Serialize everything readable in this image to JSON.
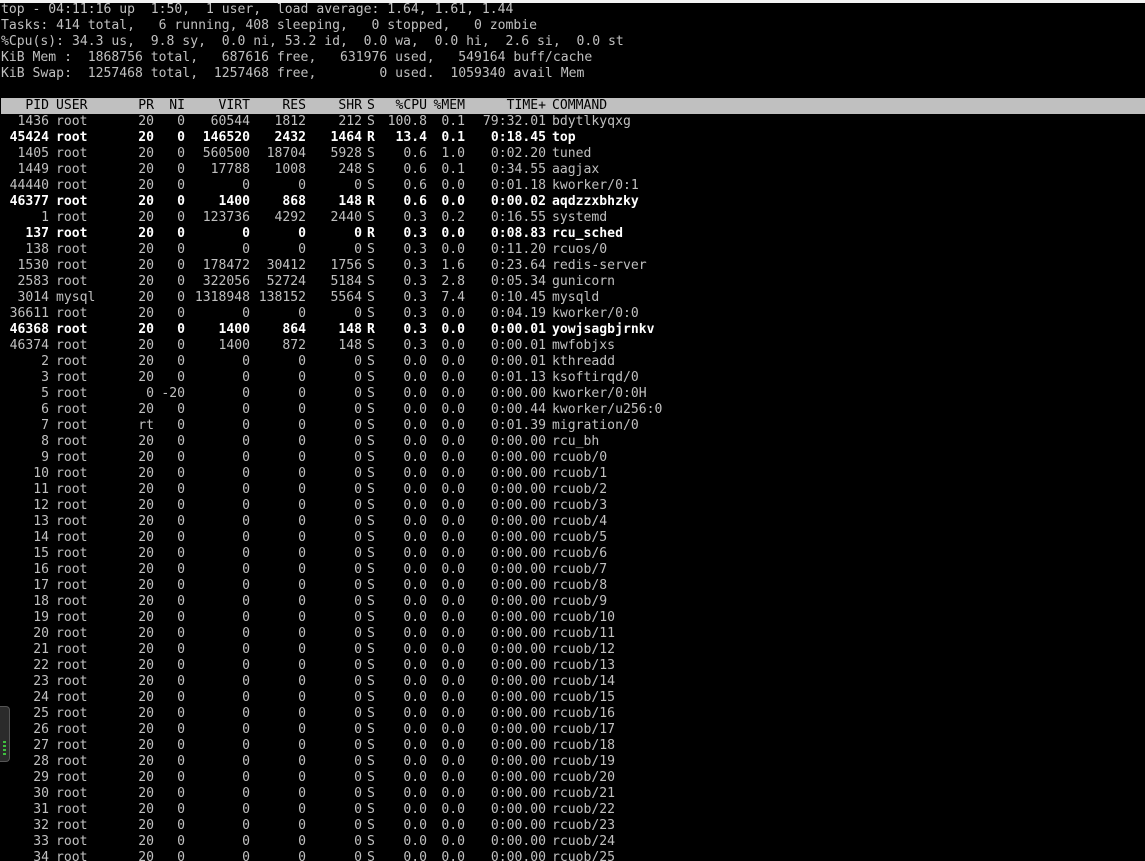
{
  "summary": {
    "uptime_line": "top - 04:11:16 up  1:50,  1 user,  load average: 1.64, 1.61, 1.44",
    "tasks_line": "Tasks: 414 total,   6 running, 408 sleeping,   0 stopped,   0 zombie",
    "cpu_line": "%Cpu(s): 34.3 us,  9.8 sy,  0.0 ni, 53.2 id,  0.0 wa,  0.0 hi,  2.6 si,  0.0 st",
    "mem_line": "KiB Mem :  1868756 total,   687616 free,   631976 used,   549164 buff/cache",
    "swap_line": "KiB Swap:  1257468 total,  1257468 free,        0 used.  1059340 avail Mem"
  },
  "columns": [
    "PID",
    "USER",
    "PR",
    "NI",
    "VIRT",
    "RES",
    "SHR",
    "S",
    "%CPU",
    "%MEM",
    "TIME+",
    "COMMAND"
  ],
  "processes": [
    [
      "1436",
      "root",
      "20",
      "0",
      "60544",
      "1812",
      "212",
      "S",
      "100.8",
      "0.1",
      "79:32.01",
      "bdytlkyqxg"
    ],
    [
      "45424",
      "root",
      "20",
      "0",
      "146520",
      "2432",
      "1464",
      "R",
      "13.4",
      "0.1",
      "0:18.45",
      "top"
    ],
    [
      "1405",
      "root",
      "20",
      "0",
      "560500",
      "18704",
      "5928",
      "S",
      "0.6",
      "1.0",
      "0:02.20",
      "tuned"
    ],
    [
      "1449",
      "root",
      "20",
      "0",
      "17788",
      "1008",
      "248",
      "S",
      "0.6",
      "0.1",
      "0:34.55",
      "aagjax"
    ],
    [
      "44440",
      "root",
      "20",
      "0",
      "0",
      "0",
      "0",
      "S",
      "0.6",
      "0.0",
      "0:01.18",
      "kworker/0:1"
    ],
    [
      "46377",
      "root",
      "20",
      "0",
      "1400",
      "868",
      "148",
      "R",
      "0.6",
      "0.0",
      "0:00.02",
      "aqdzzxbhzky"
    ],
    [
      "1",
      "root",
      "20",
      "0",
      "123736",
      "4292",
      "2440",
      "S",
      "0.3",
      "0.2",
      "0:16.55",
      "systemd"
    ],
    [
      "137",
      "root",
      "20",
      "0",
      "0",
      "0",
      "0",
      "R",
      "0.3",
      "0.0",
      "0:08.83",
      "rcu_sched"
    ],
    [
      "138",
      "root",
      "20",
      "0",
      "0",
      "0",
      "0",
      "S",
      "0.3",
      "0.0",
      "0:11.20",
      "rcuos/0"
    ],
    [
      "1530",
      "root",
      "20",
      "0",
      "178472",
      "30412",
      "1756",
      "S",
      "0.3",
      "1.6",
      "0:23.64",
      "redis-server"
    ],
    [
      "2583",
      "root",
      "20",
      "0",
      "322056",
      "52724",
      "5184",
      "S",
      "0.3",
      "2.8",
      "0:05.34",
      "gunicorn"
    ],
    [
      "3014",
      "mysql",
      "20",
      "0",
      "1318948",
      "138152",
      "5564",
      "S",
      "0.3",
      "7.4",
      "0:10.45",
      "mysqld"
    ],
    [
      "36611",
      "root",
      "20",
      "0",
      "0",
      "0",
      "0",
      "S",
      "0.3",
      "0.0",
      "0:04.19",
      "kworker/0:0"
    ],
    [
      "46368",
      "root",
      "20",
      "0",
      "1400",
      "864",
      "148",
      "R",
      "0.3",
      "0.0",
      "0:00.01",
      "yowjsagbjrnkv"
    ],
    [
      "46374",
      "root",
      "20",
      "0",
      "1400",
      "872",
      "148",
      "S",
      "0.3",
      "0.0",
      "0:00.01",
      "mwfobjxs"
    ],
    [
      "2",
      "root",
      "20",
      "0",
      "0",
      "0",
      "0",
      "S",
      "0.0",
      "0.0",
      "0:00.01",
      "kthreadd"
    ],
    [
      "3",
      "root",
      "20",
      "0",
      "0",
      "0",
      "0",
      "S",
      "0.0",
      "0.0",
      "0:01.13",
      "ksoftirqd/0"
    ],
    [
      "5",
      "root",
      "0",
      "-20",
      "0",
      "0",
      "0",
      "S",
      "0.0",
      "0.0",
      "0:00.00",
      "kworker/0:0H"
    ],
    [
      "6",
      "root",
      "20",
      "0",
      "0",
      "0",
      "0",
      "S",
      "0.0",
      "0.0",
      "0:00.44",
      "kworker/u256:0"
    ],
    [
      "7",
      "root",
      "rt",
      "0",
      "0",
      "0",
      "0",
      "S",
      "0.0",
      "0.0",
      "0:01.39",
      "migration/0"
    ],
    [
      "8",
      "root",
      "20",
      "0",
      "0",
      "0",
      "0",
      "S",
      "0.0",
      "0.0",
      "0:00.00",
      "rcu_bh"
    ],
    [
      "9",
      "root",
      "20",
      "0",
      "0",
      "0",
      "0",
      "S",
      "0.0",
      "0.0",
      "0:00.00",
      "rcuob/0"
    ],
    [
      "10",
      "root",
      "20",
      "0",
      "0",
      "0",
      "0",
      "S",
      "0.0",
      "0.0",
      "0:00.00",
      "rcuob/1"
    ],
    [
      "11",
      "root",
      "20",
      "0",
      "0",
      "0",
      "0",
      "S",
      "0.0",
      "0.0",
      "0:00.00",
      "rcuob/2"
    ],
    [
      "12",
      "root",
      "20",
      "0",
      "0",
      "0",
      "0",
      "S",
      "0.0",
      "0.0",
      "0:00.00",
      "rcuob/3"
    ],
    [
      "13",
      "root",
      "20",
      "0",
      "0",
      "0",
      "0",
      "S",
      "0.0",
      "0.0",
      "0:00.00",
      "rcuob/4"
    ],
    [
      "14",
      "root",
      "20",
      "0",
      "0",
      "0",
      "0",
      "S",
      "0.0",
      "0.0",
      "0:00.00",
      "rcuob/5"
    ],
    [
      "15",
      "root",
      "20",
      "0",
      "0",
      "0",
      "0",
      "S",
      "0.0",
      "0.0",
      "0:00.00",
      "rcuob/6"
    ],
    [
      "16",
      "root",
      "20",
      "0",
      "0",
      "0",
      "0",
      "S",
      "0.0",
      "0.0",
      "0:00.00",
      "rcuob/7"
    ],
    [
      "17",
      "root",
      "20",
      "0",
      "0",
      "0",
      "0",
      "S",
      "0.0",
      "0.0",
      "0:00.00",
      "rcuob/8"
    ],
    [
      "18",
      "root",
      "20",
      "0",
      "0",
      "0",
      "0",
      "S",
      "0.0",
      "0.0",
      "0:00.00",
      "rcuob/9"
    ],
    [
      "19",
      "root",
      "20",
      "0",
      "0",
      "0",
      "0",
      "S",
      "0.0",
      "0.0",
      "0:00.00",
      "rcuob/10"
    ],
    [
      "20",
      "root",
      "20",
      "0",
      "0",
      "0",
      "0",
      "S",
      "0.0",
      "0.0",
      "0:00.00",
      "rcuob/11"
    ],
    [
      "21",
      "root",
      "20",
      "0",
      "0",
      "0",
      "0",
      "S",
      "0.0",
      "0.0",
      "0:00.00",
      "rcuob/12"
    ],
    [
      "22",
      "root",
      "20",
      "0",
      "0",
      "0",
      "0",
      "S",
      "0.0",
      "0.0",
      "0:00.00",
      "rcuob/13"
    ],
    [
      "23",
      "root",
      "20",
      "0",
      "0",
      "0",
      "0",
      "S",
      "0.0",
      "0.0",
      "0:00.00",
      "rcuob/14"
    ],
    [
      "24",
      "root",
      "20",
      "0",
      "0",
      "0",
      "0",
      "S",
      "0.0",
      "0.0",
      "0:00.00",
      "rcuob/15"
    ],
    [
      "25",
      "root",
      "20",
      "0",
      "0",
      "0",
      "0",
      "S",
      "0.0",
      "0.0",
      "0:00.00",
      "rcuob/16"
    ],
    [
      "26",
      "root",
      "20",
      "0",
      "0",
      "0",
      "0",
      "S",
      "0.0",
      "0.0",
      "0:00.00",
      "rcuob/17"
    ],
    [
      "27",
      "root",
      "20",
      "0",
      "0",
      "0",
      "0",
      "S",
      "0.0",
      "0.0",
      "0:00.00",
      "rcuob/18"
    ],
    [
      "28",
      "root",
      "20",
      "0",
      "0",
      "0",
      "0",
      "S",
      "0.0",
      "0.0",
      "0:00.00",
      "rcuob/19"
    ],
    [
      "29",
      "root",
      "20",
      "0",
      "0",
      "0",
      "0",
      "S",
      "0.0",
      "0.0",
      "0:00.00",
      "rcuob/20"
    ],
    [
      "30",
      "root",
      "20",
      "0",
      "0",
      "0",
      "0",
      "S",
      "0.0",
      "0.0",
      "0:00.00",
      "rcuob/21"
    ],
    [
      "31",
      "root",
      "20",
      "0",
      "0",
      "0",
      "0",
      "S",
      "0.0",
      "0.0",
      "0:00.00",
      "rcuob/22"
    ],
    [
      "32",
      "root",
      "20",
      "0",
      "0",
      "0",
      "0",
      "S",
      "0.0",
      "0.0",
      "0:00.00",
      "rcuob/23"
    ],
    [
      "33",
      "root",
      "20",
      "0",
      "0",
      "0",
      "0",
      "S",
      "0.0",
      "0.0",
      "0:00.00",
      "rcuob/24"
    ],
    [
      "34",
      "root",
      "20",
      "0",
      "0",
      "0",
      "0",
      "S",
      "0.0",
      "0.0",
      "0:00.00",
      "rcuob/25"
    ]
  ],
  "colors": {
    "background": "#000000",
    "text": "#c0c0c0",
    "running_text": "#ffffff",
    "header_bar": "#c0c0c0"
  },
  "side_widget_icon": "panel-handle-icon"
}
